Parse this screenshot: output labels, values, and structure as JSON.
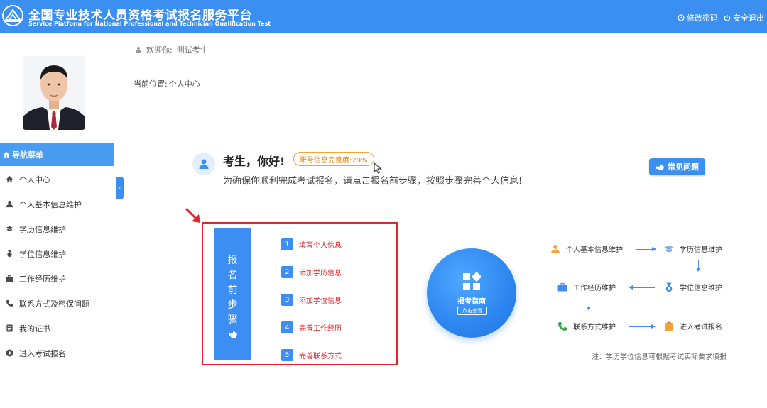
{
  "header": {
    "title": "全国专业技术人员资格考试报名服务平台",
    "subtitle": "Service Platform for National Professional and Technician Qualification Test",
    "actions": {
      "change_password": "修改密码",
      "logout": "安全退出"
    }
  },
  "sidebar": {
    "nav_title": "导航菜单",
    "items": [
      {
        "label": "个人中心",
        "icon": "home-icon"
      },
      {
        "label": "个人基本信息维护",
        "icon": "user-icon"
      },
      {
        "label": "学历信息维护",
        "icon": "graduation-cap-icon"
      },
      {
        "label": "学位信息维护",
        "icon": "medal-icon"
      },
      {
        "label": "工作经历维护",
        "icon": "briefcase-icon"
      },
      {
        "label": "联系方式及密保问题",
        "icon": "phone-icon"
      },
      {
        "label": "我的证书",
        "icon": "certificate-icon"
      },
      {
        "label": "进入考试报名",
        "icon": "arrow-circle-icon"
      }
    ]
  },
  "main": {
    "welcome_prefix": "欢迎你:",
    "welcome_user": "测试考生",
    "location_label": "当前位置:",
    "location_value": "个人中心",
    "greeting_title": "考生，你好!",
    "completeness": "账号信息完整度:29%",
    "greeting_subtitle": "为确保你顺利完成考试报名，请点击报名前步骤，按照步骤完善个人信息!",
    "faq_button": "常见问题",
    "steps_banner": [
      "报",
      "名",
      "前",
      "步",
      "骤"
    ],
    "steps": [
      {
        "num": "1",
        "label": "填写个人信息"
      },
      {
        "num": "2",
        "label": "添加学历信息"
      },
      {
        "num": "3",
        "label": "添加学位信息"
      },
      {
        "num": "4",
        "label": "完善工作经历"
      },
      {
        "num": "5",
        "label": "完善联系方式"
      }
    ],
    "guide": {
      "label": "报考指南",
      "sub": "点击查看"
    },
    "flow": {
      "personal": "个人基本信息维护",
      "education": "学历信息维护",
      "degree": "学位信息维护",
      "work": "工作经历维护",
      "contact": "联系方式维护",
      "enter": "进入考试报名"
    },
    "note": "注：学历学位信息可根据考试实际要求填报"
  },
  "colors": {
    "primary": "#3a8ff0",
    "accent_red": "#e0252b",
    "accent_orange": "#e38a1b"
  }
}
